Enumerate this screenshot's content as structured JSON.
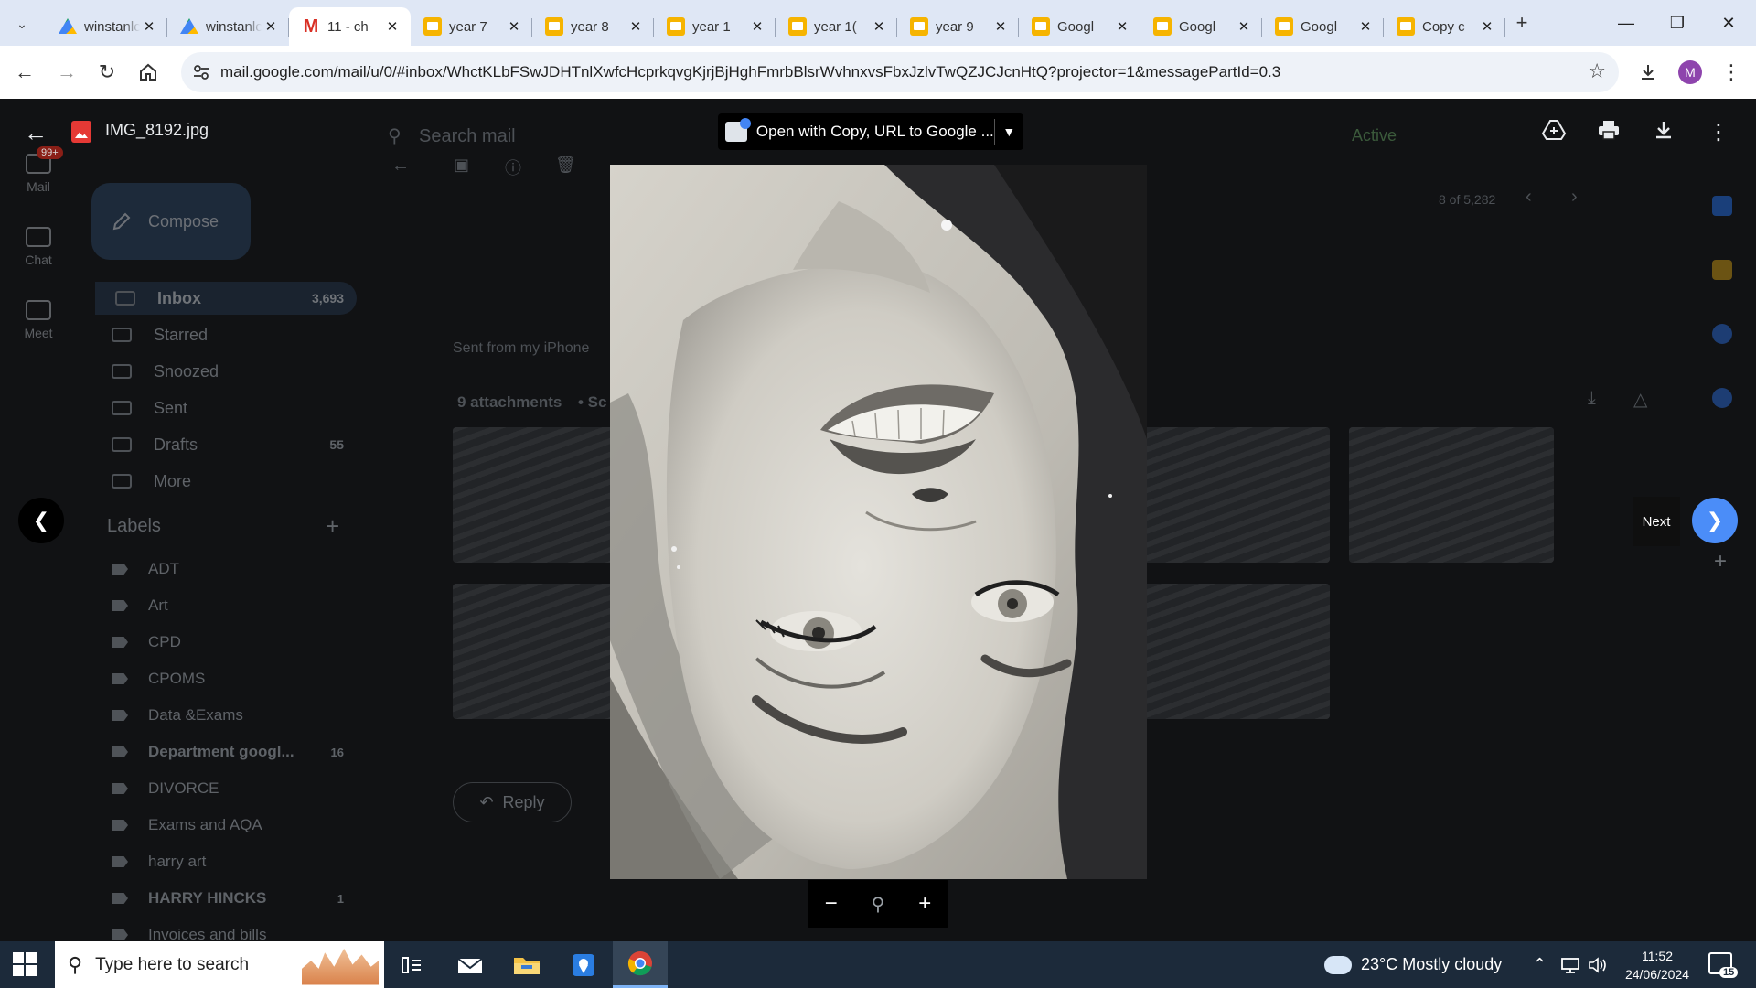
{
  "browser": {
    "tabs": [
      {
        "label": "winstanley",
        "icon": "drive-icon",
        "active": false
      },
      {
        "label": "winstanley",
        "icon": "drive-icon",
        "active": false
      },
      {
        "label": "11 - ch",
        "icon": "gmail-icon",
        "active": true
      },
      {
        "label": "year 7",
        "icon": "slides-icon",
        "active": false
      },
      {
        "label": "year 8",
        "icon": "slides-icon",
        "active": false
      },
      {
        "label": "year 1",
        "icon": "slides-icon",
        "active": false
      },
      {
        "label": "year 1(",
        "icon": "slides-icon",
        "active": false
      },
      {
        "label": "year 9",
        "icon": "slides-icon",
        "active": false
      },
      {
        "label": "Googl",
        "icon": "slides-icon",
        "active": false
      },
      {
        "label": "Googl",
        "icon": "slides-icon",
        "active": false
      },
      {
        "label": "Googl",
        "icon": "slides-icon",
        "active": false
      },
      {
        "label": "Copy c",
        "icon": "slides-icon",
        "active": false
      }
    ],
    "url": "mail.google.com/mail/u/0/#inbox/WhctKLbFSwJDHTnlXwfcHcprkqvgKjrjBjHghFmrbBlsrWvhnxvsFbxJzlvTwQZJCJcnHtQ?projector=1&messagePartId=0.3",
    "profile_initial": "M"
  },
  "gmail": {
    "rail": [
      {
        "label": "Mail",
        "badge": "99+"
      },
      {
        "label": "Chat"
      },
      {
        "label": "Meet"
      }
    ],
    "compose_label": "Compose",
    "search_placeholder": "Search mail",
    "status": "Active",
    "nav": [
      {
        "label": "Inbox",
        "count": "3,693"
      },
      {
        "label": "Starred",
        "count": ""
      },
      {
        "label": "Snoozed",
        "count": ""
      },
      {
        "label": "Sent",
        "count": ""
      },
      {
        "label": "Drafts",
        "count": "55"
      },
      {
        "label": "More",
        "count": ""
      }
    ],
    "labels_heading": "Labels",
    "labels": [
      {
        "label": "ADT",
        "count": ""
      },
      {
        "label": "Art",
        "count": ""
      },
      {
        "label": "CPD",
        "count": ""
      },
      {
        "label": "CPOMS",
        "count": ""
      },
      {
        "label": "Data &Exams",
        "count": ""
      },
      {
        "label": "Department googl...",
        "count": "16"
      },
      {
        "label": "DIVORCE",
        "count": ""
      },
      {
        "label": "Exams and AQA",
        "count": ""
      },
      {
        "label": "harry art",
        "count": ""
      },
      {
        "label": "HARRY HINCKS",
        "count": "1"
      },
      {
        "label": "Invoices and bills",
        "count": ""
      }
    ],
    "sent_from": "Sent from my iPhone",
    "attachments_label": "9 attachments",
    "attachments_suffix": "• Sc",
    "pager": "8 of 5,282",
    "reply_label": "Reply"
  },
  "viewer": {
    "filename": "IMG_8192.jpg",
    "open_with_label": "Open with Copy, URL to Google ...",
    "next_tooltip": "Next"
  },
  "taskbar": {
    "search_placeholder": "Type here to search",
    "weather": "23°C  Mostly cloudy",
    "time": "11:52",
    "date": "24/06/2024",
    "notifications": "15"
  }
}
